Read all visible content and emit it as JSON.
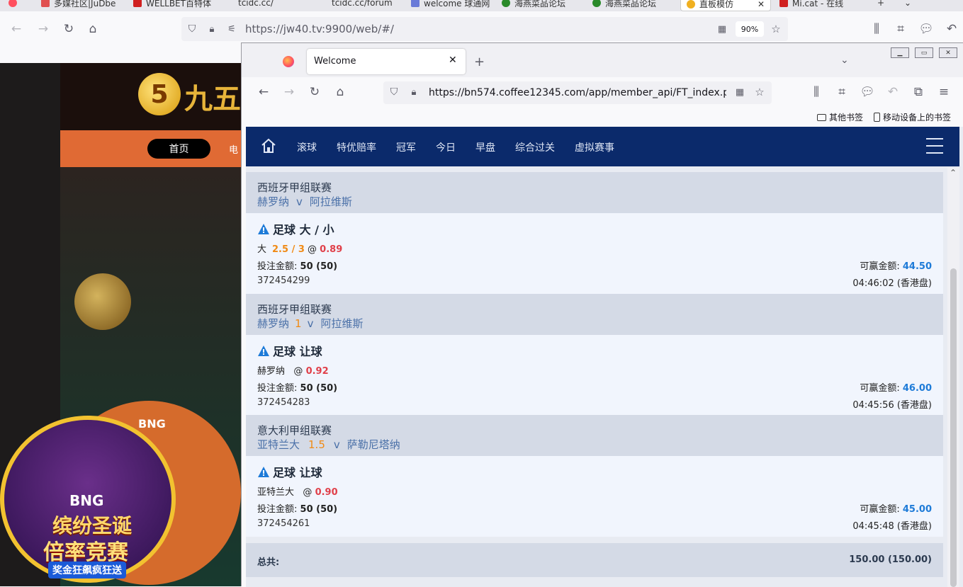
{
  "outer_browser": {
    "tabs": [
      {
        "label": "多媒社区|JuDbe",
        "color": "#e05050"
      },
      {
        "label": "WELLBET百特体",
        "color": "#d02020"
      },
      {
        "label": "tcidc.cc/",
        "color": "#888888"
      },
      {
        "label": "tcidc.cc/forum",
        "color": "#888888"
      },
      {
        "label": "welcome 球通网",
        "color": "#6a7bd8"
      },
      {
        "label": "海燕菜品论坛",
        "color": "#2a8a2a"
      },
      {
        "label": "海燕菜品论坛",
        "color": "#2a8a2a"
      },
      {
        "label": "直板模仿",
        "color": "#f0b020"
      },
      {
        "label": "Mi.cat - 在线",
        "color": "#d02020"
      }
    ],
    "url": "https://jw40.tv:9900/web/#/",
    "zoom": "90%"
  },
  "background_site": {
    "logo_text": "九五",
    "nav_home": "首页",
    "nav_next": "电",
    "banner_brand": "BNG",
    "banner_title1": "缤纷圣诞",
    "banner_title2": "倍率竞赛",
    "banner_subtitle": "奖金狂飙疯狂送",
    "corner_brand": "BNG"
  },
  "inner_browser": {
    "tab_title": "Welcome",
    "url": "https://bn574.coffee12345.com/app/member_api/FT_index.php?",
    "bookmarks": [
      "其他书签",
      "移动设备上的书签"
    ]
  },
  "page": {
    "nav": [
      "滚球",
      "特优赔率",
      "冠军",
      "今日",
      "早盘",
      "综合过关",
      "虚拟赛事"
    ],
    "bets": [
      {
        "league": "西班牙甲组联赛",
        "home": "赫罗纳",
        "handicap": "",
        "vs": "v",
        "away": "阿拉维斯",
        "type": "足球 大 / 小",
        "pick": "大",
        "line": "2.5 / 3",
        "at": "@",
        "odds": "0.89",
        "stake_label": "投注金额:",
        "stake": "50 (50)",
        "win_label": "可赢金额:",
        "win": "44.50",
        "ticket": "372454299",
        "time": "04:46:02 (香港盘)"
      },
      {
        "league": "西班牙甲组联赛",
        "home": "赫罗纳",
        "handicap": "1",
        "vs": "v",
        "away": "阿拉维斯",
        "type": "足球 让球",
        "pick": "赫罗纳",
        "line": "",
        "at": "@",
        "odds": "0.92",
        "stake_label": "投注金额:",
        "stake": "50 (50)",
        "win_label": "可赢金额:",
        "win": "46.00",
        "ticket": "372454283",
        "time": "04:45:56 (香港盘)"
      },
      {
        "league": "意大利甲组联赛",
        "home": "亚特兰大",
        "handicap": "1.5",
        "vs": "v",
        "away": "萨勒尼塔纳",
        "type": "足球 让球",
        "pick": "亚特兰大",
        "line": "",
        "at": "@",
        "odds": "0.90",
        "stake_label": "投注金额:",
        "stake": "50 (50)",
        "win_label": "可赢金额:",
        "win": "45.00",
        "ticket": "372454261",
        "time": "04:45:48 (香港盘)"
      }
    ],
    "total_label": "总共:",
    "total_value": "150.00 (150.00)"
  }
}
